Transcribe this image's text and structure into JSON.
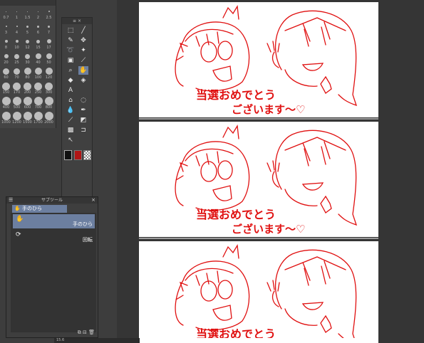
{
  "brush_size": {
    "labels": [
      "0.7",
      "1",
      "1.5",
      "2",
      "2.5",
      "3",
      "4",
      "5",
      "6",
      "7",
      "8",
      "10",
      "12",
      "15",
      "17",
      "20",
      "25",
      "30",
      "40",
      "50",
      "60",
      "70",
      "80",
      "100",
      "120",
      "150",
      "170",
      "200",
      "250",
      "300",
      "400",
      "500",
      "600",
      "700",
      "800",
      "1000",
      "1200",
      "1500",
      "1700",
      "2000"
    ]
  },
  "tools": {
    "items": [
      {
        "name": "marquee-icon",
        "glyph": "⬚"
      },
      {
        "name": "select-pen-icon",
        "glyph": "╱"
      },
      {
        "name": "pen-icon",
        "glyph": "✎"
      },
      {
        "name": "move-icon",
        "glyph": "✥"
      },
      {
        "name": "lasso-icon",
        "glyph": "➰"
      },
      {
        "name": "magic-wand-icon",
        "glyph": "✦"
      },
      {
        "name": "operation-icon",
        "glyph": "▣"
      },
      {
        "name": "eyedropper-icon",
        "glyph": "⟋"
      },
      {
        "name": "zoom-icon",
        "glyph": "⌕"
      },
      {
        "name": "hand-icon",
        "glyph": "✋"
      },
      {
        "name": "fill-icon",
        "glyph": "◆"
      },
      {
        "name": "eraser-icon",
        "glyph": "◈"
      },
      {
        "name": "text-icon",
        "glyph": "A"
      },
      {
        "name": "none",
        "glyph": ""
      },
      {
        "name": "frame-icon",
        "glyph": "⌂"
      },
      {
        "name": "blend-icon",
        "glyph": "◌"
      },
      {
        "name": "water-icon",
        "glyph": "💧"
      },
      {
        "name": "airbrush-icon",
        "glyph": "✒"
      },
      {
        "name": "ruler-icon",
        "glyph": "⟋"
      },
      {
        "name": "gradient-icon",
        "glyph": "◩"
      },
      {
        "name": "figure-icon",
        "glyph": "▩"
      },
      {
        "name": "balloon-icon",
        "glyph": "⊐"
      },
      {
        "name": "object-select-icon",
        "glyph": "↖"
      },
      {
        "name": "none2",
        "glyph": ""
      }
    ],
    "main_color": "#111111",
    "sub_color": "#b01515",
    "transparent_color": "checker"
  },
  "subtool": {
    "title": "サブツール",
    "group": "手のひら",
    "item_label": "手のひら",
    "second_icon": "回転"
  },
  "canvas": {
    "text_line1": "当選おめでとう",
    "text_line2": "ございます〜♡",
    "ink_color": "#e01010"
  },
  "status": {
    "zoom": "15.6"
  }
}
